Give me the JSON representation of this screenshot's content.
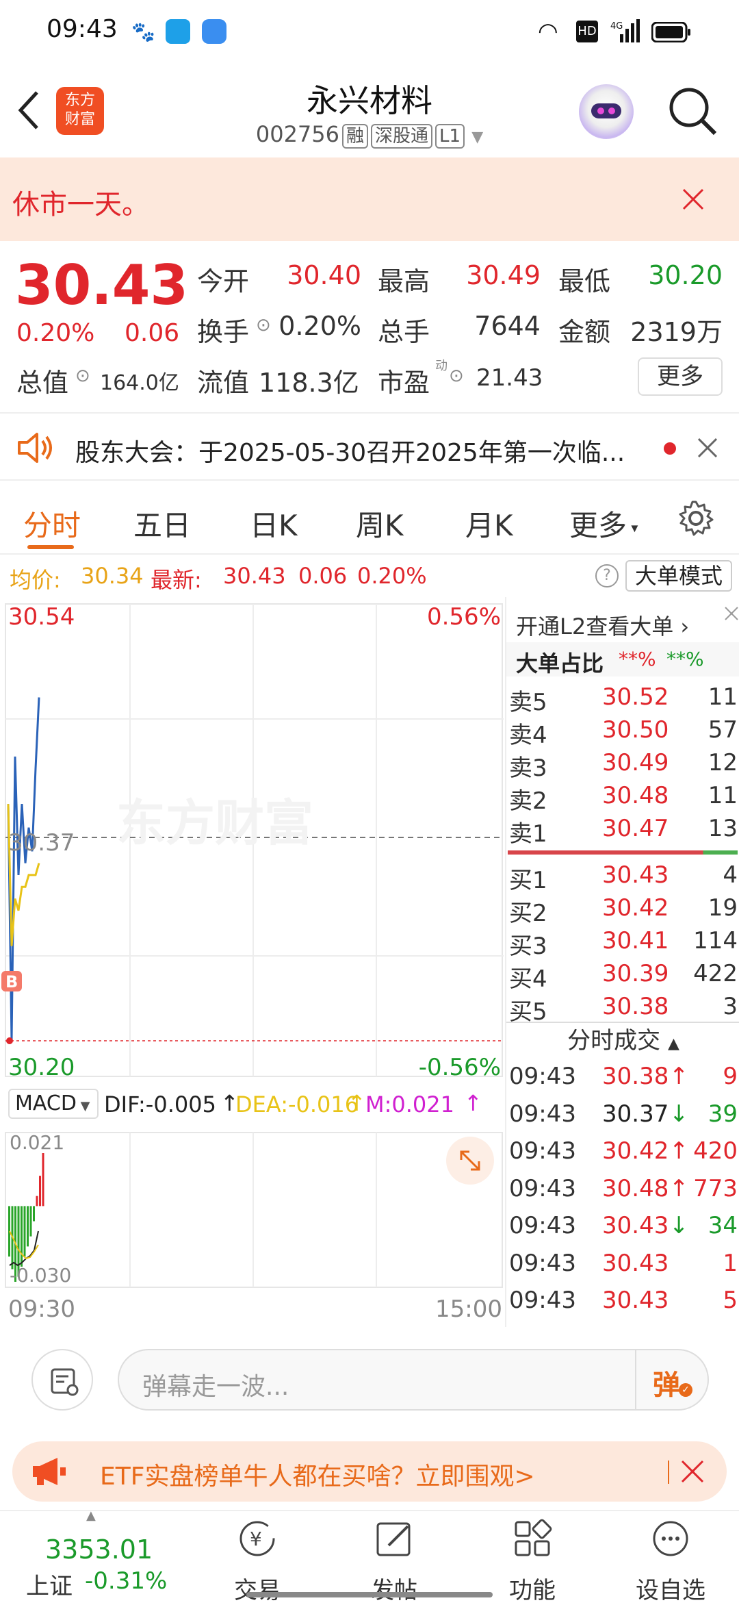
{
  "status_bar": {
    "time": "09:43"
  },
  "header": {
    "title": "永兴材料",
    "code": "002756",
    "tags": [
      "融",
      "深股通",
      "L1"
    ],
    "logo_text_1": "东方",
    "logo_text_2": "财富"
  },
  "notice": {
    "text": "休市一天。"
  },
  "quote": {
    "price": "30.43",
    "change_pct": "0.20%",
    "change": "0.06",
    "open_label": "今开",
    "open": "30.40",
    "high_label": "最高",
    "high": "30.49",
    "low_label": "最低",
    "low": "30.20",
    "turnover_label": "换手",
    "turnover": "0.20%",
    "volume_label": "总手",
    "volume": "7644",
    "amount_label": "金额",
    "amount": "2319万",
    "mktcap_label": "总值",
    "mktcap": "164.0亿",
    "float_label": "流值",
    "float": "118.3亿",
    "pe_label": "市盈",
    "pe_sup": "动",
    "pe": "21.43",
    "more_label": "更多"
  },
  "announcement": {
    "text": "股东大会：于2025-05-30召开2025年第一次临..."
  },
  "tabs": [
    "分时",
    "五日",
    "日K",
    "周K",
    "月K",
    "更多"
  ],
  "infobar": {
    "avg_label": "均价:",
    "avg": "30.34",
    "latest_label": "最新:",
    "latest": "30.43",
    "latest_change": "0.06",
    "latest_pct": "0.20%",
    "mode_label": "大单模式"
  },
  "chart_data": {
    "type": "line",
    "y_top": "30.54",
    "y_mid": "30.37",
    "y_bottom": "30.20",
    "pct_top": "0.56%",
    "pct_bottom": "-0.56%",
    "x_start": "09:30",
    "x_end": "15:00",
    "watermark": "东方财富",
    "series": [
      {
        "name": "price",
        "values": [
          30.4,
          30.2,
          30.44,
          30.34,
          30.4,
          30.35,
          30.38,
          30.36,
          30.43,
          30.49
        ]
      },
      {
        "name": "avg",
        "values": [
          30.4,
          30.28,
          30.32,
          30.31,
          30.33,
          30.33,
          30.34,
          30.34,
          30.34,
          30.35
        ]
      }
    ],
    "indicator": {
      "name": "MACD",
      "dif_label": "DIF:-0.005",
      "dea_label": "DEA:-0.016",
      "m_label": "M:0.021",
      "top": "0.021",
      "bottom": "-0.030",
      "bars": [
        -0.02,
        -0.025,
        -0.03,
        -0.028,
        -0.024,
        -0.02,
        -0.016,
        -0.012,
        -0.006,
        0.004,
        0.012,
        0.021
      ]
    }
  },
  "orderbook": {
    "promo": "开通L2查看大单",
    "big_ratio_label": "大单占比",
    "big_ratio_sell": "**%",
    "big_ratio_buy": "**%",
    "asks": [
      {
        "label": "卖5",
        "price": "30.52",
        "vol": "11"
      },
      {
        "label": "卖4",
        "price": "30.50",
        "vol": "57"
      },
      {
        "label": "卖3",
        "price": "30.49",
        "vol": "12"
      },
      {
        "label": "卖2",
        "price": "30.48",
        "vol": "11"
      },
      {
        "label": "卖1",
        "price": "30.47",
        "vol": "13"
      }
    ],
    "bids": [
      {
        "label": "买1",
        "price": "30.43",
        "vol": "4"
      },
      {
        "label": "买2",
        "price": "30.42",
        "vol": "19"
      },
      {
        "label": "买3",
        "price": "30.41",
        "vol": "114"
      },
      {
        "label": "买4",
        "price": "30.39",
        "vol": "422"
      },
      {
        "label": "买5",
        "price": "30.38",
        "vol": "3"
      }
    ],
    "ticks_label": "分时成交",
    "ticks": [
      {
        "time": "09:43",
        "price": "30.38",
        "dir": "↑",
        "vol": "9",
        "pc": "red",
        "vc": "red"
      },
      {
        "time": "09:43",
        "price": "30.37",
        "dir": "↓",
        "vol": "39",
        "pc": "dark",
        "vc": "green"
      },
      {
        "time": "09:43",
        "price": "30.42",
        "dir": "↑",
        "vol": "420",
        "pc": "red",
        "vc": "red"
      },
      {
        "time": "09:43",
        "price": "30.48",
        "dir": "↑",
        "vol": "773",
        "pc": "red",
        "vc": "red"
      },
      {
        "time": "09:43",
        "price": "30.43",
        "dir": "↓",
        "vol": "34",
        "pc": "red",
        "vc": "green"
      },
      {
        "time": "09:43",
        "price": "30.43",
        "dir": "",
        "vol": "1",
        "pc": "red",
        "vc": "red"
      },
      {
        "time": "09:43",
        "price": "30.43",
        "dir": "",
        "vol": "5",
        "pc": "red",
        "vc": "red"
      }
    ]
  },
  "comment": {
    "placeholder": "弹幕走一波...",
    "danmu_label": "弹"
  },
  "banner": {
    "text": "ETF实盘榜单牛人都在买啥？立即围观>"
  },
  "bottom_nav": {
    "index_value": "3353.01",
    "index_name": "上证",
    "index_change": "-0.31%",
    "items": [
      "交易",
      "发帖",
      "功能",
      "设自选"
    ]
  },
  "colors": {
    "accent": "#e86a1a",
    "up": "#e0262c",
    "down": "#1a9a2a"
  }
}
